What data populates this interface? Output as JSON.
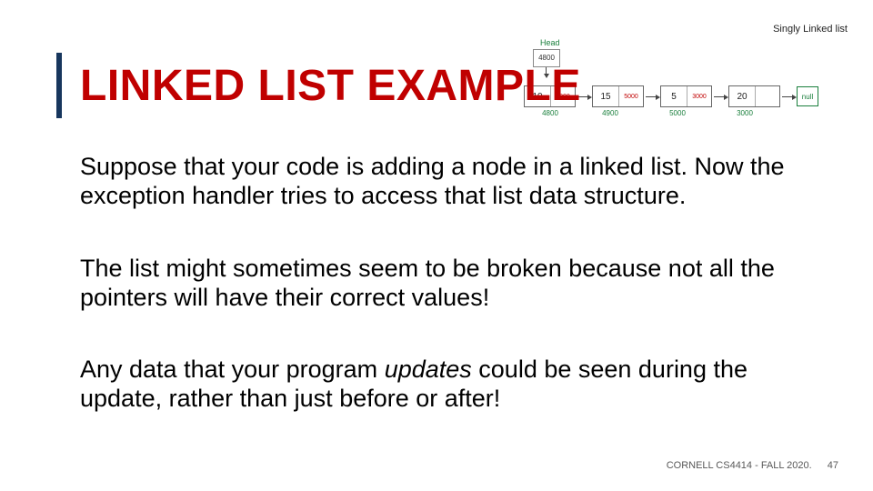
{
  "title": "LINKED LIST EXAMPLE",
  "paragraphs": {
    "p1_pre": "Suppose that your code is adding a node in a linked list. Now the exception handler tries to access that list data structure.",
    "p2": "The list might sometimes seem to be broken because not all the pointers will have their correct values!",
    "p3_a": "Any data that your program ",
    "p3_em": "updates",
    "p3_b": " could be seen during the update, rather than just before or after!"
  },
  "footer": {
    "course": "CORNELL CS4414 - FALL 2020.",
    "slide_no": "47"
  },
  "diagram": {
    "title": "Singly Linked list",
    "head_label": "Head",
    "head_value": "4800",
    "null_label": "null",
    "nodes": [
      {
        "data": "10",
        "ptr": "4900",
        "addr": "4800"
      },
      {
        "data": "15",
        "ptr": "5000",
        "addr": "4900"
      },
      {
        "data": "5",
        "ptr": "3000",
        "addr": "5000"
      },
      {
        "data": "20",
        "ptr": "",
        "addr": "3000"
      }
    ]
  }
}
